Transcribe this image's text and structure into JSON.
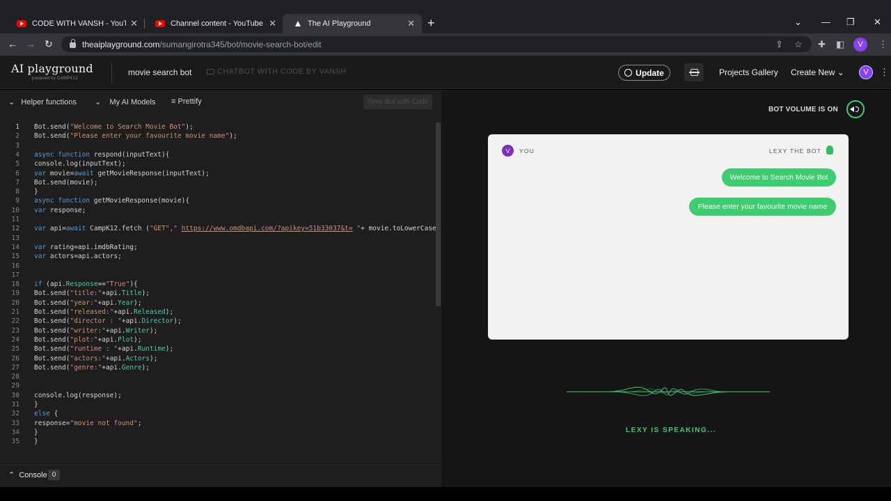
{
  "browser": {
    "tabs": [
      {
        "title": "CODE WITH VANSH - YouTube",
        "active": false,
        "favicon": "youtube-icon"
      },
      {
        "title": "Channel content - YouTube Studio",
        "active": false,
        "favicon": "youtube-icon"
      },
      {
        "title": "The AI Playground",
        "active": true,
        "favicon": "ai-playground-icon"
      }
    ],
    "url_host": "theaiplayground.com",
    "url_path": "/sumangirotra345/bot/movie-search-bot/edit",
    "profile_initial": "V"
  },
  "header": {
    "logo": "AI playground",
    "logo_sub": "powered by CAMPK12",
    "bot_name": "movie search bot",
    "bot_description": "CHATBOT WITH CODE BY VANSH",
    "update_label": "Update",
    "projects_gallery": "Projects Gallery",
    "create_new": "Create New",
    "avatar_initial": "V"
  },
  "editor": {
    "toolbar": {
      "helper_functions": "Helper functions",
      "my_ai_models": "My AI Models",
      "prettify": "Prettify",
      "sync": "Sync Bot with Code"
    },
    "line_numbers": [
      "1",
      "2",
      "3",
      "4",
      "5",
      "6",
      "7",
      "8",
      "9",
      "10",
      "11",
      "12",
      "13",
      "14",
      "15",
      "16",
      "17",
      "18",
      "19",
      "20",
      "21",
      "22",
      "23",
      "24",
      "25",
      "26",
      "27",
      "28",
      "29",
      "30",
      "31",
      "32",
      "33",
      "34",
      "35"
    ],
    "code_lines": [
      [
        {
          "t": "Bot.send(",
          "c": ""
        },
        {
          "t": "\"Welcome to Search Movie Bot\"",
          "c": "st"
        },
        {
          "t": ");",
          "c": ""
        }
      ],
      [
        {
          "t": "Bot.send(",
          "c": ""
        },
        {
          "t": "\"Please enter your favourite movie name\"",
          "c": "st"
        },
        {
          "t": ");",
          "c": ""
        }
      ],
      [],
      [
        {
          "t": "async function",
          "c": "kw"
        },
        {
          "t": " respond(inputText){",
          "c": ""
        }
      ],
      [
        {
          "t": "console.log(inputText);",
          "c": ""
        }
      ],
      [
        {
          "t": "var",
          "c": "kw"
        },
        {
          "t": " movie=",
          "c": ""
        },
        {
          "t": "await",
          "c": "kw"
        },
        {
          "t": " getMovieResponse(inputText);",
          "c": ""
        }
      ],
      [
        {
          "t": "Bot.send(movie);",
          "c": ""
        }
      ],
      [
        {
          "t": "}",
          "c": ""
        }
      ],
      [
        {
          "t": "async function",
          "c": "kw"
        },
        {
          "t": " getMovieResponse(movie){",
          "c": ""
        }
      ],
      [
        {
          "t": "var",
          "c": "kw"
        },
        {
          "t": " response;",
          "c": ""
        }
      ],
      [],
      [
        {
          "t": "var",
          "c": "kw"
        },
        {
          "t": " api=",
          "c": ""
        },
        {
          "t": "await",
          "c": "kw"
        },
        {
          "t": " CampK12.fetch (",
          "c": ""
        },
        {
          "t": "\"GET\",\"",
          "c": "st"
        },
        {
          "t": " ",
          "c": ""
        },
        {
          "t": "https://www.omdbapi.com/?apikey=51b33037&t=",
          "c": "st ul"
        },
        {
          "t": " \"",
          "c": "st"
        },
        {
          "t": "+ movie.toLowerCase());",
          "c": ""
        }
      ],
      [],
      [
        {
          "t": "var",
          "c": "kw"
        },
        {
          "t": " rating=api.imdbRating;",
          "c": ""
        }
      ],
      [
        {
          "t": "var",
          "c": "kw"
        },
        {
          "t": " actors=api.actors;",
          "c": ""
        }
      ],
      [],
      [],
      [
        {
          "t": "if",
          "c": "kw"
        },
        {
          "t": " (api.",
          "c": ""
        },
        {
          "t": "Response",
          "c": "pr"
        },
        {
          "t": "==",
          "c": ""
        },
        {
          "t": "\"True\"",
          "c": "st"
        },
        {
          "t": "){",
          "c": ""
        }
      ],
      [
        {
          "t": "Bot.send(",
          "c": ""
        },
        {
          "t": "\"title:\"",
          "c": "st"
        },
        {
          "t": "+api.",
          "c": ""
        },
        {
          "t": "Title",
          "c": "pr"
        },
        {
          "t": ");",
          "c": ""
        }
      ],
      [
        {
          "t": "Bot.send(",
          "c": ""
        },
        {
          "t": "\"year:\"",
          "c": "st"
        },
        {
          "t": "+api.",
          "c": ""
        },
        {
          "t": "Year",
          "c": "pr"
        },
        {
          "t": ");",
          "c": ""
        }
      ],
      [
        {
          "t": "Bot.send(",
          "c": ""
        },
        {
          "t": "\"released:\"",
          "c": "st"
        },
        {
          "t": "+api.",
          "c": ""
        },
        {
          "t": "Released",
          "c": "pr"
        },
        {
          "t": ");",
          "c": ""
        }
      ],
      [
        {
          "t": "Bot.send(",
          "c": ""
        },
        {
          "t": "\"director : \"",
          "c": "st"
        },
        {
          "t": "+api.",
          "c": ""
        },
        {
          "t": "Director",
          "c": "pr"
        },
        {
          "t": ");",
          "c": ""
        }
      ],
      [
        {
          "t": "Bot.send(",
          "c": ""
        },
        {
          "t": "\"writer:\"",
          "c": "st"
        },
        {
          "t": "+api.",
          "c": ""
        },
        {
          "t": "Writer",
          "c": "pr"
        },
        {
          "t": ");",
          "c": ""
        }
      ],
      [
        {
          "t": "Bot.send(",
          "c": ""
        },
        {
          "t": "\"plot:\"",
          "c": "st"
        },
        {
          "t": "+api.",
          "c": ""
        },
        {
          "t": "Plot",
          "c": "pr"
        },
        {
          "t": ");",
          "c": ""
        }
      ],
      [
        {
          "t": "Bot.send(",
          "c": ""
        },
        {
          "t": "\"runtime : \"",
          "c": "st"
        },
        {
          "t": "+api.",
          "c": ""
        },
        {
          "t": "Runtime",
          "c": "pr"
        },
        {
          "t": ");",
          "c": ""
        }
      ],
      [
        {
          "t": "Bot.send(",
          "c": ""
        },
        {
          "t": "\"actors:\"",
          "c": "st"
        },
        {
          "t": "+api.",
          "c": ""
        },
        {
          "t": "Actors",
          "c": "pr"
        },
        {
          "t": ");",
          "c": ""
        }
      ],
      [
        {
          "t": "Bot.send(",
          "c": ""
        },
        {
          "t": "\"genre:\"",
          "c": "st"
        },
        {
          "t": "+api.",
          "c": ""
        },
        {
          "t": "Genre",
          "c": "pr"
        },
        {
          "t": ");",
          "c": ""
        }
      ],
      [],
      [],
      [
        {
          "t": "console.log(response);",
          "c": ""
        }
      ],
      [
        {
          "t": "}",
          "c": ""
        }
      ],
      [
        {
          "t": "else",
          "c": "kw"
        },
        {
          "t": " {",
          "c": ""
        }
      ],
      [
        {
          "t": "response=",
          "c": ""
        },
        {
          "t": "\"movie not found\"",
          "c": "st"
        },
        {
          "t": ";",
          "c": ""
        }
      ],
      [
        {
          "t": "}",
          "c": ""
        }
      ],
      [
        {
          "t": "}",
          "c": ""
        }
      ]
    ],
    "console_label": "Console",
    "console_count": "0"
  },
  "preview": {
    "volume_label": "BOT VOLUME IS ON",
    "you_initial": "V",
    "you_label": "YOU",
    "bot_label": "LEXY THE BOT",
    "messages": [
      "Welcome to Search Movie Bot",
      "Please enter your favourite movie name"
    ],
    "speaking_label": "LEXY IS SPEAKING..."
  },
  "colors": {
    "accent_green": "#3dcc70",
    "avatar_purple": "#8a3ffc",
    "editor_bg": "#1e1e1e"
  }
}
